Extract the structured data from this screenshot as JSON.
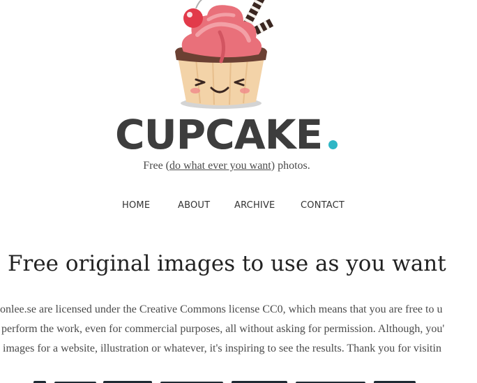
{
  "site": {
    "brand": "CUPCAKE",
    "tagline_before": "Free (",
    "tagline_link": "do what ever you want",
    "tagline_after": ") photos."
  },
  "nav": {
    "items": [
      {
        "label": "HOME"
      },
      {
        "label": "ABOUT"
      },
      {
        "label": "ARCHIVE"
      },
      {
        "label": "CONTACT"
      }
    ]
  },
  "main": {
    "heading": "Free original images to use as you want",
    "paragraph_lines": [
      "onlee.se are licensed under the Creative Commons license CC0, which means that you are free to u",
      "perform the work, even for commercial purposes, all without asking for permission. Although, you'",
      "images for a website, illustration or whatever, it's inspiring to see the results. Thank you for visitin"
    ]
  },
  "colors": {
    "brand_text": "#3d3d3d",
    "accent_dot": "#2fb6c5",
    "frosting": "#e9707a",
    "cup": "#f1d2a6"
  },
  "icons": {
    "logo": "cupcake-logo-icon"
  }
}
